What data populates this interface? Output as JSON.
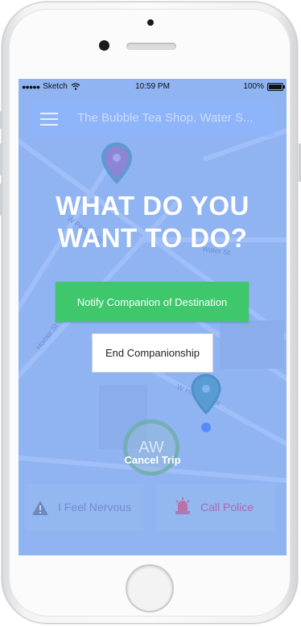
{
  "status_bar": {
    "carrier": "Sketch",
    "time": "10:59 PM",
    "battery": "100%"
  },
  "search": {
    "text": "The Bubble Tea Shop, Water S..."
  },
  "map": {
    "streets": [
      "W Pender St",
      "Water St",
      "Homer St",
      "W Hastings St"
    ]
  },
  "prompt": {
    "line1": "WHAT DO YOU",
    "line2": "WANT TO DO?"
  },
  "actions": {
    "notify_label": "Notify Companion of Destination",
    "end_label": "End Companionship"
  },
  "companion": {
    "initials": "AW",
    "cancel_label": "Cancel Trip"
  },
  "bottom": {
    "nervous_label": "I Feel Nervous",
    "police_label": "Call Police"
  },
  "colors": {
    "overlay": "#689cff",
    "notify_button": "#3ec86b",
    "end_button": "#ffffff",
    "pin": "#4a9aa6",
    "pin_start": "#b06fa8"
  }
}
